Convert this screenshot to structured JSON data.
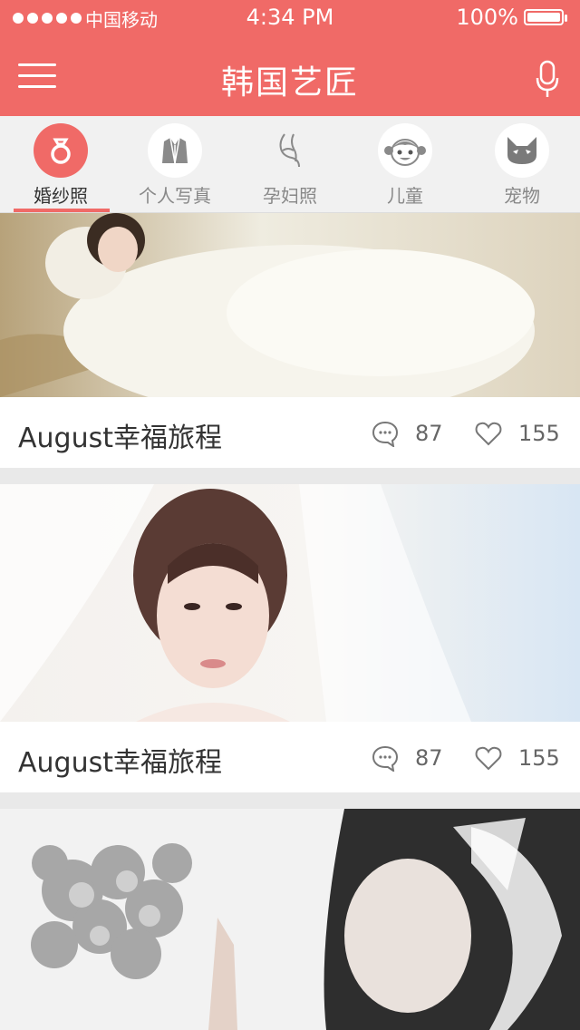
{
  "status_bar": {
    "carrier": "中国移动",
    "time": "4:34 PM",
    "battery": "100%",
    "signal_bars": 5
  },
  "header": {
    "title": "韩国艺匠",
    "menu_icon": "hamburger-menu-icon",
    "mic_icon": "microphone-icon"
  },
  "tabs": [
    {
      "label": "婚纱照",
      "icon": "ring-icon",
      "active": true
    },
    {
      "label": "个人写真",
      "icon": "jacket-icon",
      "active": false
    },
    {
      "label": "孕妇照",
      "icon": "pregnant-icon",
      "active": false
    },
    {
      "label": "儿童",
      "icon": "child-face-icon",
      "active": false
    },
    {
      "label": "宠物",
      "icon": "cat-icon",
      "active": false
    }
  ],
  "feed": [
    {
      "title": "August幸福旅程",
      "comments": "87",
      "likes": "155"
    },
    {
      "title": "August幸福旅程",
      "comments": "87",
      "likes": "155"
    },
    {
      "title": "",
      "comments": "",
      "likes": ""
    }
  ],
  "colors": {
    "accent": "#f06a67",
    "tab_bg": "#f1f1f1",
    "feed_bg": "#e9e9e9"
  }
}
